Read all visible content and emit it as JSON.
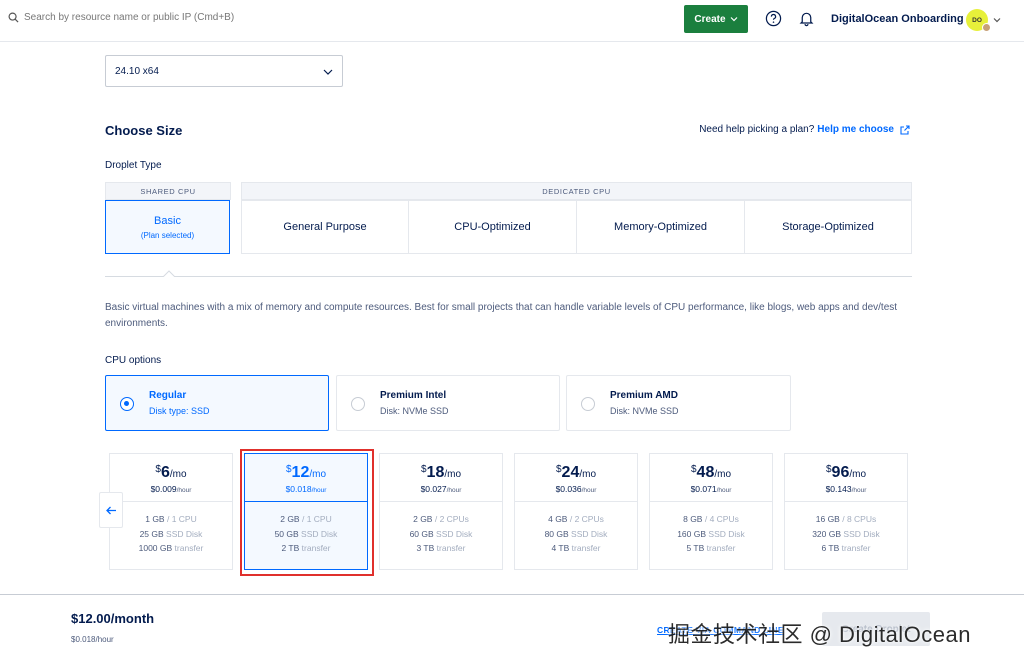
{
  "topbar": {
    "search_placeholder": "Search by resource name or public IP (Cmd+B)",
    "create_label": "Create",
    "team_name": "DigitalOcean Onboarding",
    "avatar_initials": "DO"
  },
  "image_version": {
    "selected": "24.10 x64"
  },
  "choose_size": {
    "title": "Choose Size",
    "help_text": "Need help picking a plan?",
    "help_link": "Help me choose"
  },
  "droplet_type": {
    "label": "Droplet Type",
    "shared_header": "SHARED CPU",
    "dedicated_header": "DEDICATED CPU",
    "tabs": [
      {
        "label": "Basic",
        "sub": "(Plan selected)"
      },
      {
        "label": "General Purpose"
      },
      {
        "label": "CPU-Optimized"
      },
      {
        "label": "Memory-Optimized"
      },
      {
        "label": "Storage-Optimized"
      }
    ],
    "selected_index": 0
  },
  "description": "Basic virtual machines with a mix of memory and compute resources. Best for small projects that can handle variable levels of CPU performance, like blogs, web apps and dev/test environments.",
  "cpu_options": {
    "label": "CPU options",
    "items": [
      {
        "name": "Regular",
        "disk": "Disk type: SSD",
        "selected": true
      },
      {
        "name": "Premium Intel",
        "disk": "Disk: NVMe SSD",
        "selected": false
      },
      {
        "name": "Premium AMD",
        "disk": "Disk: NVMe SSD",
        "selected": false
      }
    ]
  },
  "plans": [
    {
      "currency": "$",
      "price": "6",
      "per": "/mo",
      "hourly": "$0.009",
      "hourly_unit": "/hour",
      "ram": "1 GB",
      "cpu": "/ 1 CPU",
      "disk": "25 GB",
      "disk_type": "SSD Disk",
      "transfer": "1000 GB",
      "transfer_label": "transfer"
    },
    {
      "currency": "$",
      "price": "12",
      "per": "/mo",
      "hourly": "$0.018",
      "hourly_unit": "/hour",
      "ram": "2 GB",
      "cpu": "/ 1 CPU",
      "disk": "50 GB",
      "disk_type": "SSD Disk",
      "transfer": "2 TB",
      "transfer_label": "transfer",
      "selected": true
    },
    {
      "currency": "$",
      "price": "18",
      "per": "/mo",
      "hourly": "$0.027",
      "hourly_unit": "/hour",
      "ram": "2 GB",
      "cpu": "/ 2 CPUs",
      "disk": "60 GB",
      "disk_type": "SSD Disk",
      "transfer": "3 TB",
      "transfer_label": "transfer"
    },
    {
      "currency": "$",
      "price": "24",
      "per": "/mo",
      "hourly": "$0.036",
      "hourly_unit": "/hour",
      "ram": "4 GB",
      "cpu": "/ 2 CPUs",
      "disk": "80 GB",
      "disk_type": "SSD Disk",
      "transfer": "4 TB",
      "transfer_label": "transfer"
    },
    {
      "currency": "$",
      "price": "48",
      "per": "/mo",
      "hourly": "$0.071",
      "hourly_unit": "/hour",
      "ram": "8 GB",
      "cpu": "/ 4 CPUs",
      "disk": "160 GB",
      "disk_type": "SSD Disk",
      "transfer": "5 TB",
      "transfer_label": "transfer"
    },
    {
      "currency": "$",
      "price": "96",
      "per": "/mo",
      "hourly": "$0.143",
      "hourly_unit": "/hour",
      "ram": "16 GB",
      "cpu": "/ 8 CPUs",
      "disk": "320 GB",
      "disk_type": "SSD Disk",
      "transfer": "6 TB",
      "transfer_label": "transfer"
    }
  ],
  "footer": {
    "total": "$12.00/month",
    "total_hourly": "$0.018/hour",
    "cli_link": "CREATE VIA COMMAND LINE",
    "create_button": "Create Droplet"
  },
  "watermark": "掘金技术社区 @ DigitalOcean",
  "colors": {
    "brand_blue": "#0069ff",
    "create_green": "#1b7f3e",
    "highlight_red": "#e0302c"
  }
}
